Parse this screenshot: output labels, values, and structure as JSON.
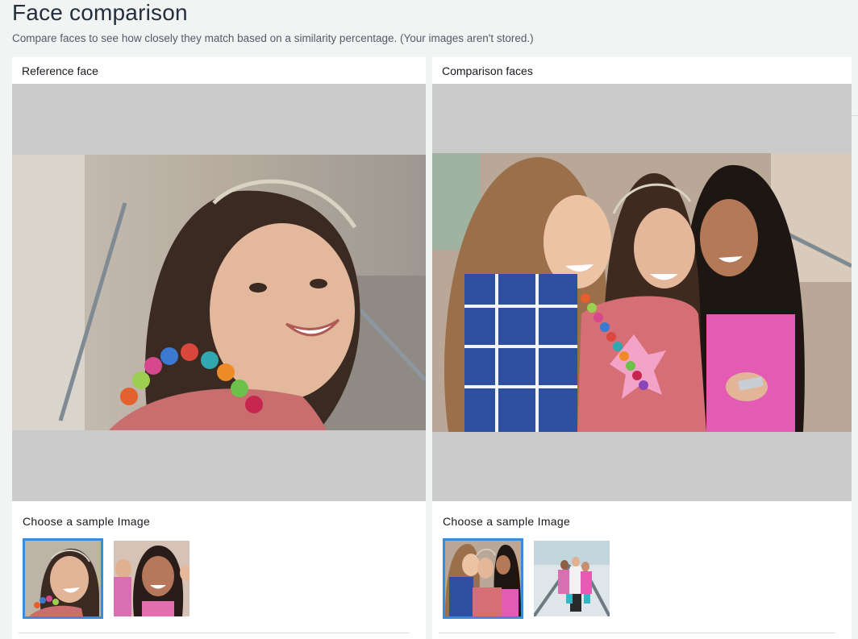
{
  "page": {
    "title": "Face comparison",
    "description": "Compare faces to see how closely they match based on a similarity percentage. (Your images aren't stored.)"
  },
  "reference": {
    "header": "Reference face",
    "sample_label": "Choose a sample Image",
    "thumbnails": [
      {
        "subject": "girl-with-headband",
        "selected": true
      },
      {
        "subject": "smiling-girl-group",
        "selected": false
      }
    ]
  },
  "comparison": {
    "header": "Comparison faces",
    "sample_label": "Choose a sample Image",
    "thumbnails": [
      {
        "subject": "three-girls-with-phone",
        "selected": true
      },
      {
        "subject": "girls-on-escalator",
        "selected": false
      }
    ]
  },
  "colors": {
    "accent_border": "#3f8ad8",
    "image_backdrop": "#cbcbcb",
    "page_background": "#f2f3f3"
  }
}
